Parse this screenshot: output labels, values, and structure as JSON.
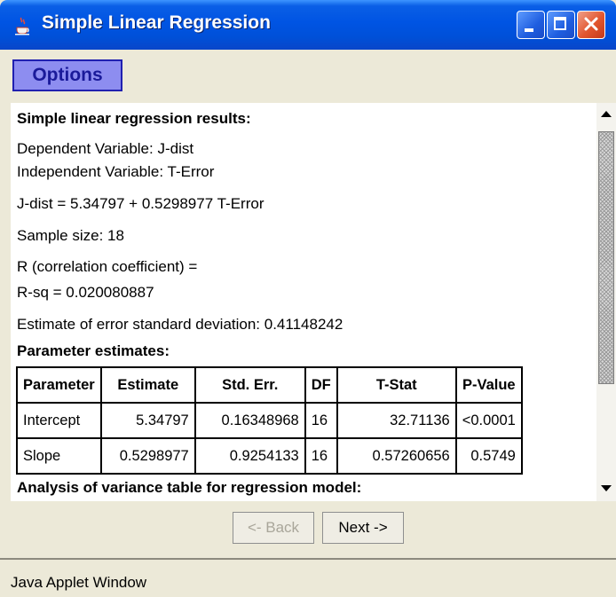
{
  "window": {
    "title": "Simple Linear Regression",
    "icon": "java-cup-icon"
  },
  "toolbar": {
    "options_label": "Options"
  },
  "results": {
    "heading": "Simple linear regression results:",
    "dependent": "Dependent Variable: J-dist",
    "independent": "Independent Variable: T-Error",
    "equation": "J-dist = 5.34797 + 0.5298977 T-Error",
    "sample_size": "Sample size: 18",
    "r_label": "R (correlation coefficient) =",
    "r_sq": "R-sq = 0.020080887",
    "std_dev": "Estimate of error standard deviation: 0.41148242",
    "param_heading": "Parameter estimates:",
    "anova_heading": "Analysis of variance table for regression model:"
  },
  "param_table": {
    "headers": [
      "Parameter",
      "Estimate",
      "Std. Err.",
      "DF",
      "T-Stat",
      "P-Value"
    ],
    "rows": [
      [
        "Intercept",
        "5.34797",
        "0.16348968",
        "16",
        "32.71136",
        "<0.0001"
      ],
      [
        "Slope",
        "0.5298977",
        "0.9254133",
        "16",
        "0.57260656",
        "0.5749"
      ]
    ]
  },
  "navigation": {
    "back_label": "<- Back",
    "next_label": "Next ->"
  },
  "status": {
    "text": "Java Applet Window"
  },
  "colors": {
    "titlebar": "#0054E3",
    "options_bg": "#8D8DF0",
    "options_text": "#1A1A9A",
    "close_button": "#E2562E"
  }
}
